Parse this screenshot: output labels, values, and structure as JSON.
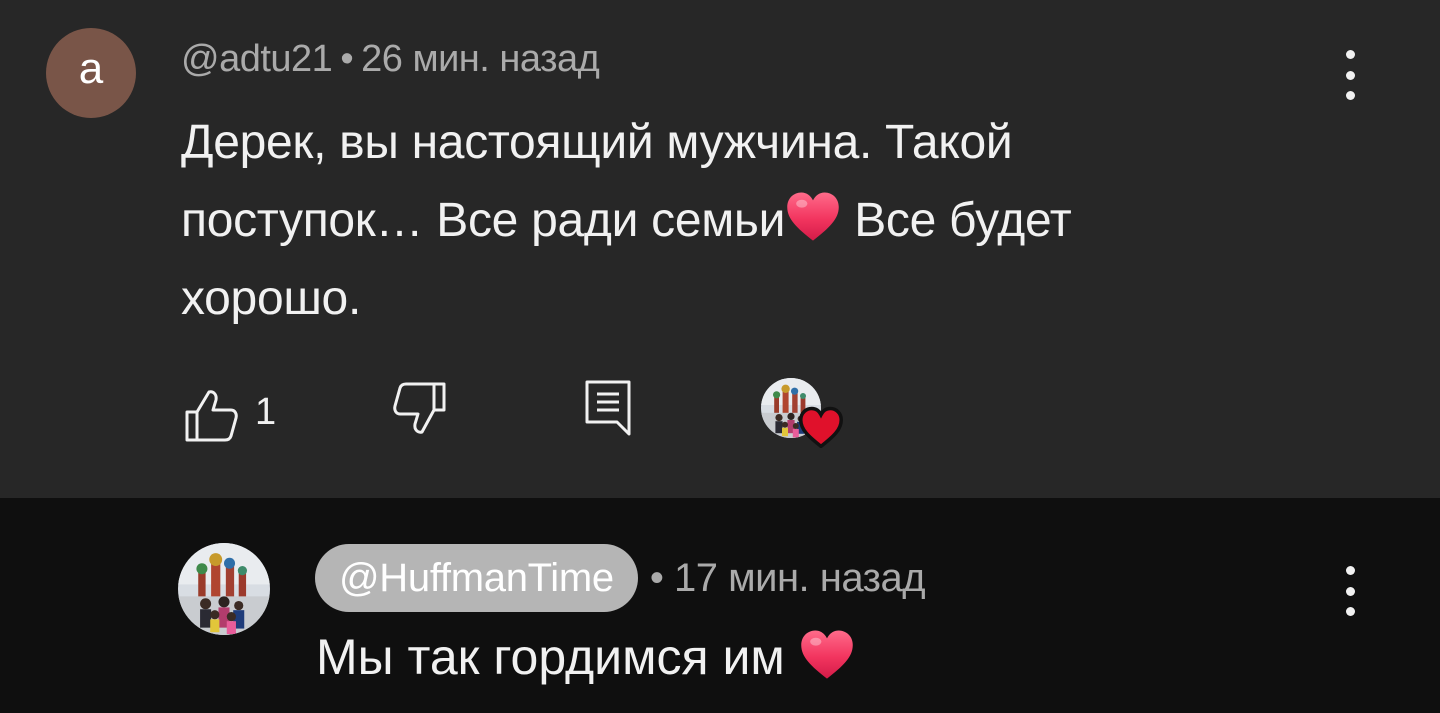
{
  "comment": {
    "avatar_letter": "a",
    "author": "@adtu21",
    "separator": "•",
    "time": "26 мин. назад",
    "text_part1": "Дерек, вы настоящий мужчина. Такой поступок… Все ради семьи",
    "text_part2": " Все будет хорошо.",
    "like_count": "1",
    "avatar_color": "#795548"
  },
  "reply": {
    "author": "@HuffmanTime",
    "separator": "•",
    "time": "17 мин. назад",
    "text": "Мы так гордимся им "
  },
  "colors": {
    "top_bg": "#272727",
    "bottom_bg": "#0f0f0f",
    "meta_text": "#aaaaaa",
    "chip_bg": "#b5b5b5",
    "heart_red": "#e0112b"
  },
  "icons": [
    "more-vert-icon",
    "thumb-up-icon",
    "thumb-down-icon",
    "reply-icon",
    "heart-icon"
  ]
}
